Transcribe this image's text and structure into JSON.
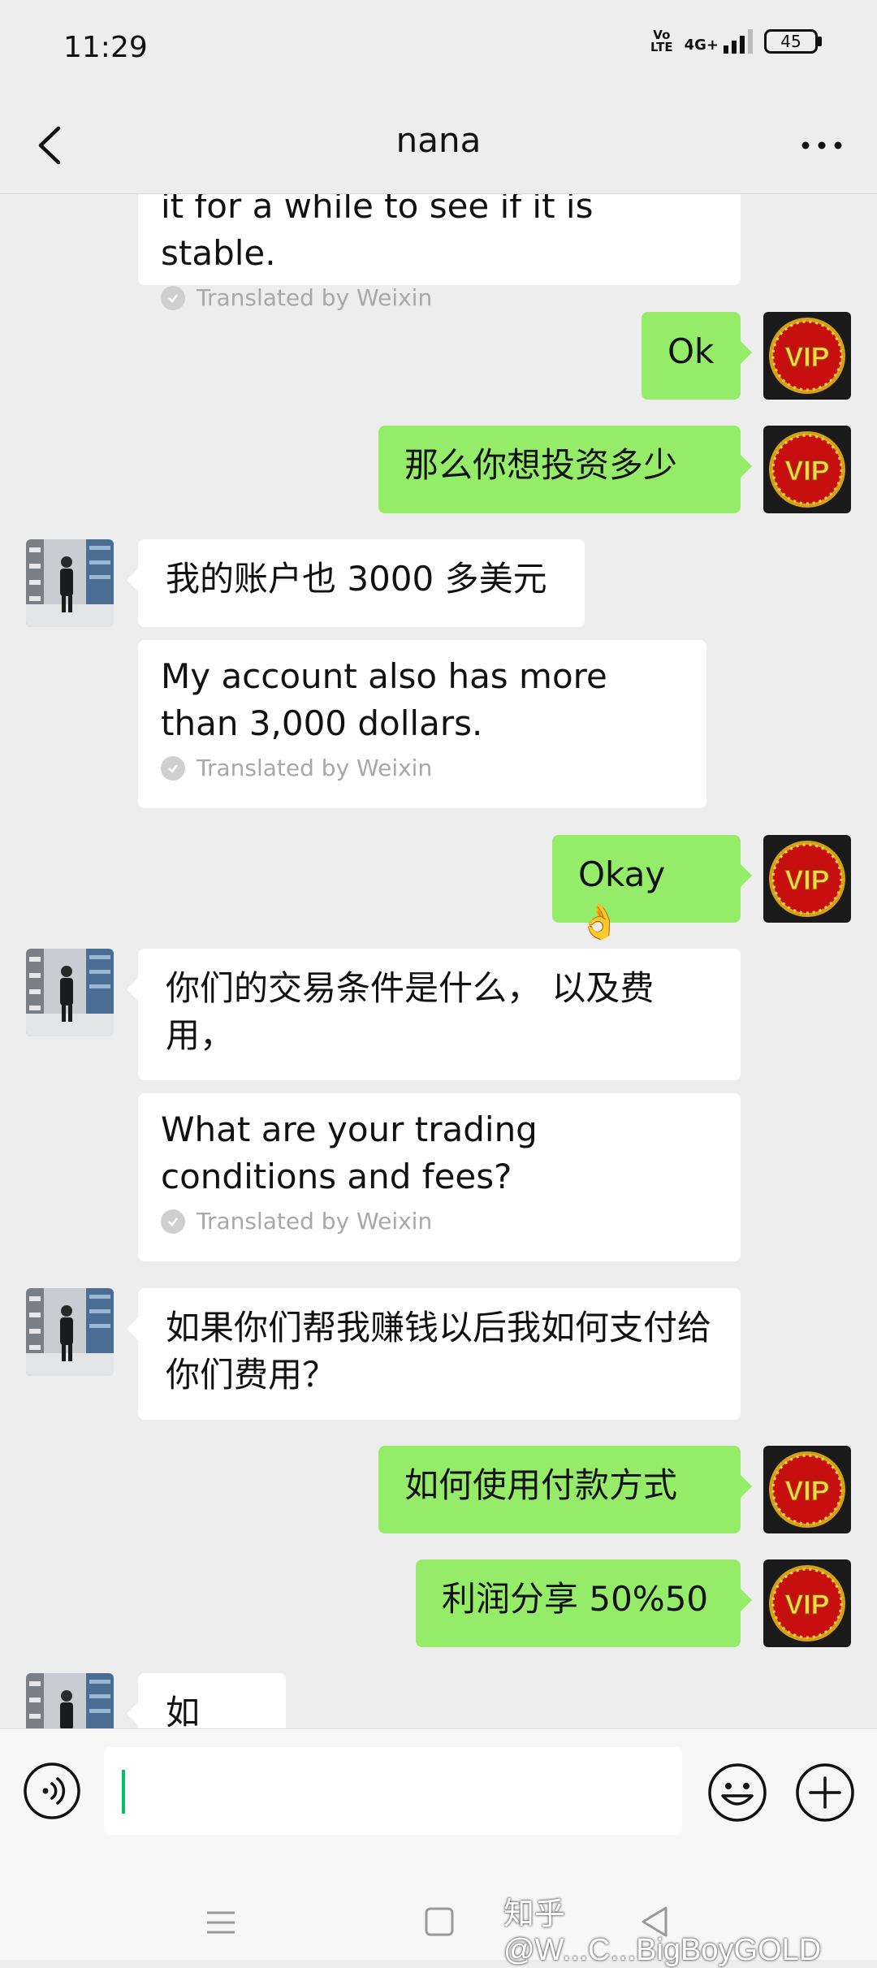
{
  "status": {
    "time": "11:29",
    "volte_line1": "Vo",
    "volte_line2": "LTE",
    "network": "4G+",
    "battery": "45"
  },
  "header": {
    "title": "nana"
  },
  "messages": [
    {
      "side": "in",
      "kind": "translation",
      "text": "it for a while to see if it is stable.",
      "note": "Translated by Weixin"
    },
    {
      "side": "out",
      "text": "Ok"
    },
    {
      "side": "out",
      "text": "那么你想投资多少"
    },
    {
      "side": "in",
      "text": "我的账户也 3000 多美元"
    },
    {
      "side": "in",
      "kind": "translation",
      "text": "My account also has more than 3,000 dollars.",
      "note": "Translated by Weixin"
    },
    {
      "side": "out",
      "text": "Okay 👌"
    },
    {
      "side": "in",
      "text": "你们的交易条件是什么， 以及费用，"
    },
    {
      "side": "in",
      "kind": "translation",
      "text": "What are your trading conditions and fees?",
      "note": "Translated by Weixin"
    },
    {
      "side": "in",
      "text": "如果你们帮我赚钱以后我如何支付给你们费用？"
    },
    {
      "side": "out",
      "text": "如何使用付款方式"
    },
    {
      "side": "out",
      "text": "利润分享 50%50"
    },
    {
      "side": "in",
      "text": "如何？"
    }
  ],
  "avatar": {
    "vip_label": "VIP"
  },
  "input": {
    "value": ""
  },
  "watermark": "知乎 @W...C...BigBoyGOLD",
  "colors": {
    "outgoing_bubble": "#95ec69",
    "incoming_bubble": "#ffffff",
    "background": "#ededed",
    "cursor": "#07c160"
  },
  "icons": [
    "back-arrow-icon",
    "more-icon",
    "voice-icon",
    "emoji-icon",
    "plus-icon",
    "check-icon",
    "menu-nav-icon",
    "home-nav-icon",
    "back-nav-icon"
  ]
}
